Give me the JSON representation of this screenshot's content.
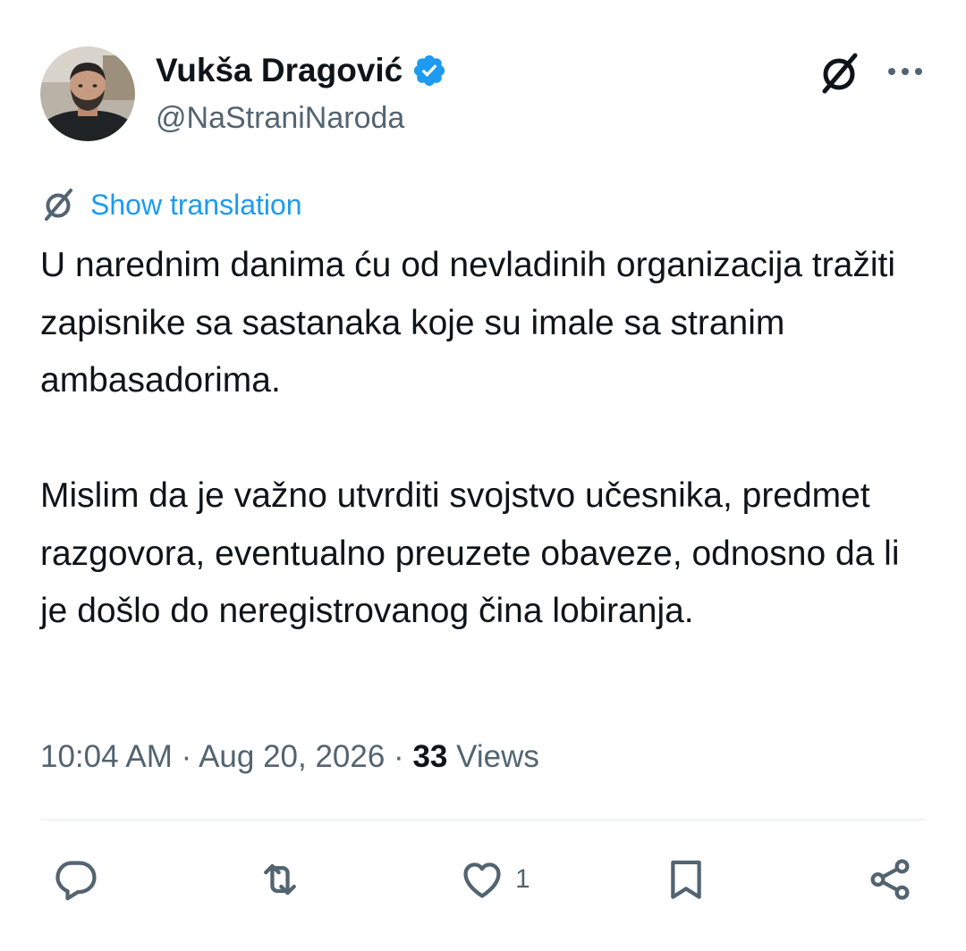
{
  "author": {
    "name": "Vukša Dragović",
    "handle": "@NaStraniNaroda",
    "verified": true
  },
  "header_actions": {
    "grok_icon": "grok-icon",
    "more_icon": "more-horizontal-icon"
  },
  "translation": {
    "icon": "translate-icon",
    "label": "Show translation"
  },
  "tweet": {
    "paragraphs": [
      "U narednim danima ću od nevladinih organizacija tražiti zapisnike sa sastanaka koje su imale sa stranim ambasadorima.",
      "Mislim da je važno utvrditi svojstvo učesnika, predmet razgovora, eventualno preuzete obaveze, odnosno da li je došlo do neregistrovanog čina lobiranja."
    ],
    "time": "10:04 AM",
    "separator": " · ",
    "date": "Aug 20, 2026",
    "views_count": "33",
    "views_label": "Views"
  },
  "actions": {
    "reply_icon": "reply-icon",
    "retweet_icon": "retweet-icon",
    "like_icon": "heart-icon",
    "like_count": "1",
    "bookmark_icon": "bookmark-icon",
    "share_icon": "share-icon"
  },
  "colors": {
    "accent": "#1d9bf0",
    "text": "#0f1419",
    "secondary": "#536471",
    "divider": "#eff3f4"
  }
}
